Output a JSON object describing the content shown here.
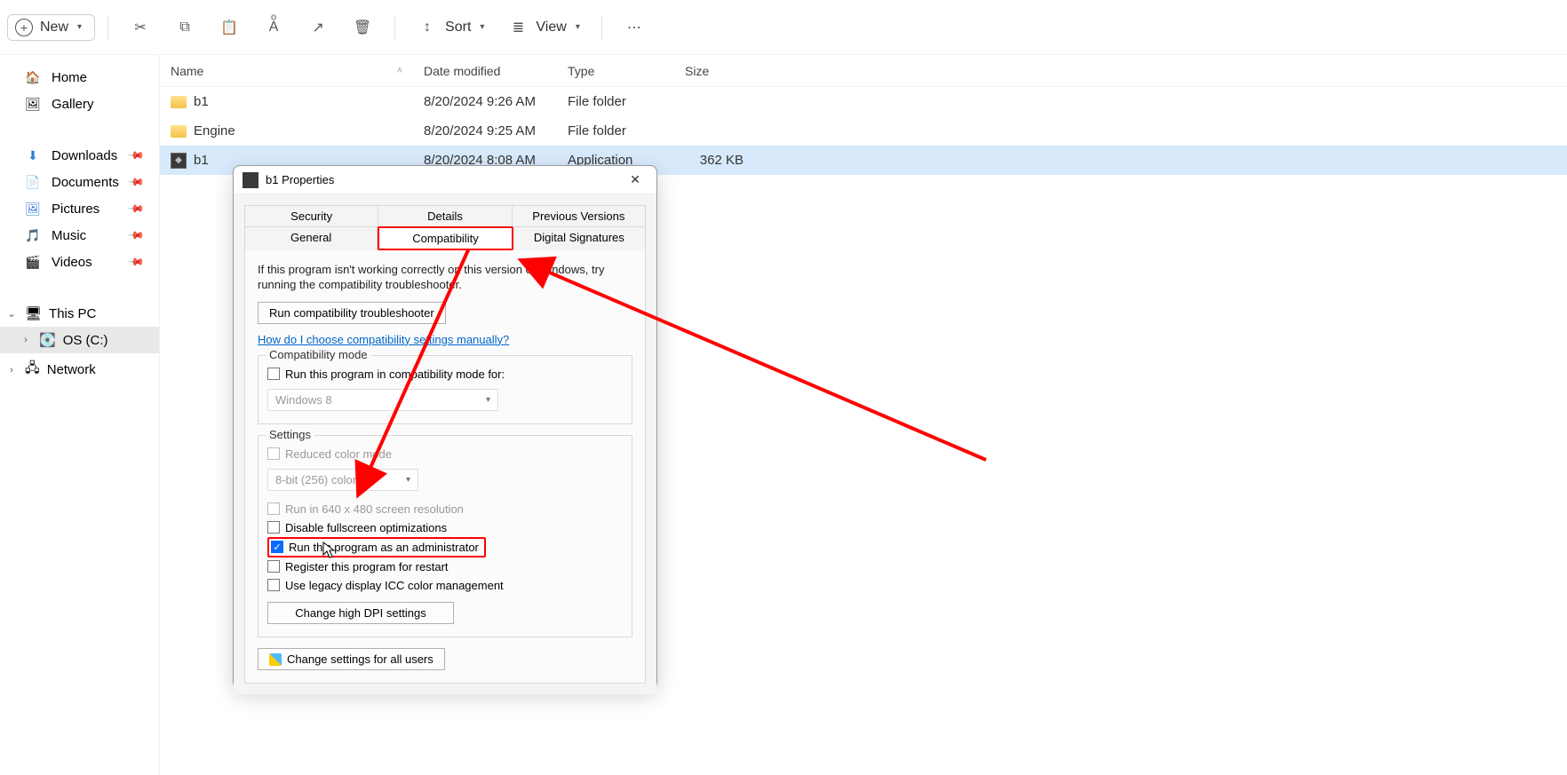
{
  "toolbar": {
    "new_label": "New",
    "sort_label": "Sort",
    "view_label": "View"
  },
  "nav": {
    "home": "Home",
    "gallery": "Gallery",
    "downloads": "Downloads",
    "documents": "Documents",
    "pictures": "Pictures",
    "music": "Music",
    "videos": "Videos",
    "this_pc": "This PC",
    "os_c": "OS (C:)",
    "network": "Network"
  },
  "columns": {
    "name": "Name",
    "date": "Date modified",
    "type": "Type",
    "size": "Size"
  },
  "rows": [
    {
      "name": "b1",
      "date": "8/20/2024 9:26 AM",
      "type": "File folder",
      "size": "",
      "kind": "folder"
    },
    {
      "name": "Engine",
      "date": "8/20/2024 9:25 AM",
      "type": "File folder",
      "size": "",
      "kind": "folder"
    },
    {
      "name": "b1",
      "date": "8/20/2024 8:08 AM",
      "type": "Application",
      "size": "362 KB",
      "kind": "app",
      "selected": true
    }
  ],
  "dialog": {
    "title": "b1 Properties",
    "tabs_row1": [
      "Security",
      "Details",
      "Previous Versions"
    ],
    "tabs_row2": [
      "General",
      "Compatibility",
      "Digital Signatures"
    ],
    "active_tab": "Compatibility",
    "info": "If this program isn't working correctly on this version of Windows, try running the compatibility troubleshooter.",
    "run_troubleshooter": "Run compatibility troubleshooter",
    "help_link": "How do I choose compatibility settings manually?",
    "compat_mode_title": "Compatibility mode",
    "compat_mode_chk": "Run this program in compatibility mode for:",
    "compat_mode_select": "Windows 8",
    "settings_title": "Settings",
    "reduced_color": "Reduced color mode",
    "color_select": "8-bit (256) color",
    "run_640": "Run in 640 x 480 screen resolution",
    "disable_fso": "Disable fullscreen optimizations",
    "run_admin": "Run this program as an administrator",
    "register_restart": "Register this program for restart",
    "legacy_icc": "Use legacy display ICC color management",
    "change_dpi": "Change high DPI settings",
    "change_all": "Change settings for all users"
  }
}
